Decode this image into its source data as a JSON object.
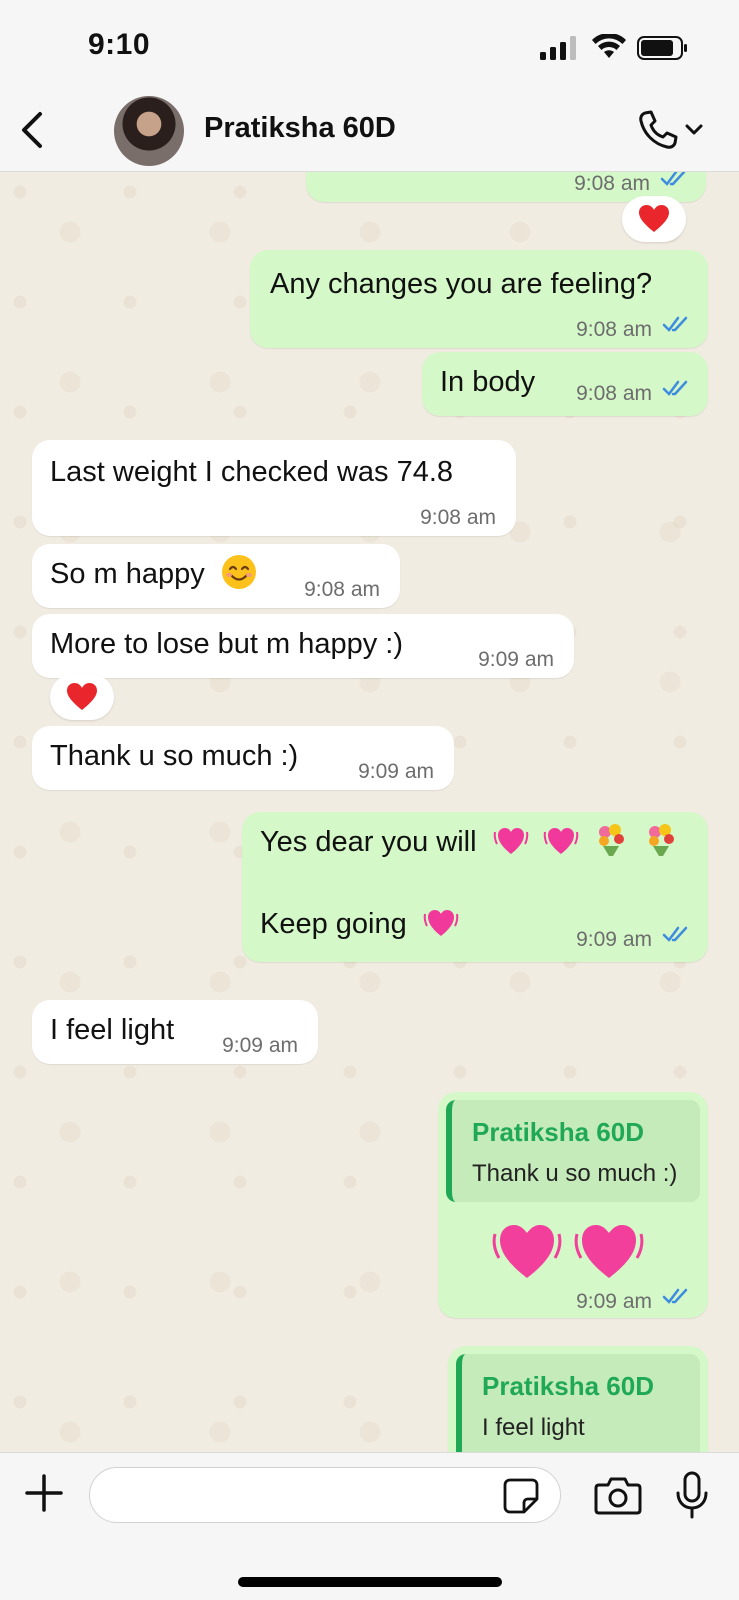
{
  "status_bar": {
    "time": "9:10"
  },
  "header": {
    "contact_name": "Pratiksha 60D"
  },
  "messages": [
    {
      "side": "out",
      "text": "",
      "time": "9:08 am"
    },
    {
      "side": "out",
      "text": "Any changes you are feeling?",
      "time": "9:08 am"
    },
    {
      "side": "out",
      "text": "In body",
      "time": "9:08 am"
    },
    {
      "side": "in",
      "text": "Last weight I checked was 74.8",
      "time": "9:08 am"
    },
    {
      "side": "in",
      "text": "So m happy",
      "time": "9:08 am"
    },
    {
      "side": "in",
      "text": "More to lose but m happy :)",
      "time": "9:09 am"
    },
    {
      "side": "in",
      "text": "Thank u so much :)",
      "time": "9:09 am"
    },
    {
      "side": "out",
      "text": "Yes dear you  will",
      "text2": "Keep going",
      "time": "9:09 am"
    },
    {
      "side": "in",
      "text": "I feel light",
      "time": "9:09 am"
    },
    {
      "side": "out",
      "quote_name": "Pratiksha 60D",
      "quote_text": "Thank u so much :)",
      "time": "9:09 am"
    },
    {
      "side": "out",
      "quote_name": "Pratiksha 60D",
      "quote_text": "I feel light"
    }
  ],
  "reactions": [
    "heart",
    "heart"
  ],
  "input": {
    "placeholder": ""
  },
  "colors": {
    "outgoing_bubble": "#d4f8c8",
    "incoming_bubble": "#ffffff",
    "read_tick": "#3d8ce0",
    "quote_accent": "#1fa855"
  }
}
